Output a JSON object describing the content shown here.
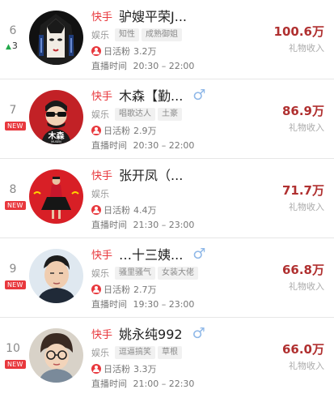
{
  "rows": [
    {
      "rank": "6",
      "change": "3",
      "is_new": false,
      "platform": "快手",
      "name": "驴嫂平荣J...",
      "gender": "",
      "category": "娱乐",
      "tags": [
        "知性",
        "成熟御姐"
      ],
      "fans_label": "日活粉",
      "fans": "3.2万",
      "live_label": "直播时间",
      "live_time": "20:30 – 22:00",
      "amount": "100.6万",
      "amount_label": "礼物收入"
    },
    {
      "rank": "7",
      "change": "",
      "is_new": true,
      "new_text": "NEW",
      "platform": "快手",
      "name": "木森【勤...",
      "gender": "♂",
      "category": "娱乐",
      "tags": [
        "唱歌达人",
        "土豪"
      ],
      "fans_label": "日活粉",
      "fans": "2.9万",
      "live_label": "直播时间",
      "live_time": "20:30 – 22:00",
      "amount": "86.9万",
      "amount_label": "礼物收入"
    },
    {
      "rank": "8",
      "change": "",
      "is_new": true,
      "new_text": "NEW",
      "platform": "快手",
      "name": "张开凤（...",
      "gender": "",
      "category": "娱乐",
      "tags": [],
      "fans_label": "日活粉",
      "fans": "4.4万",
      "live_label": "直播时间",
      "live_time": "21:30 – 23:00",
      "amount": "71.7万",
      "amount_label": "礼物收入"
    },
    {
      "rank": "9",
      "change": "",
      "is_new": true,
      "new_text": "NEW",
      "platform": "快手",
      "name": "…十三姨...",
      "gender": "♂",
      "category": "娱乐",
      "tags": [
        "骚里骚气",
        "女装大佬"
      ],
      "fans_label": "日活粉",
      "fans": "2.7万",
      "live_label": "直播时间",
      "live_time": "19:30 – 23:00",
      "amount": "66.8万",
      "amount_label": "礼物收入"
    },
    {
      "rank": "10",
      "change": "",
      "is_new": true,
      "new_text": "NEW",
      "platform": "快手",
      "name": "姚永纯992",
      "gender": "♂",
      "category": "娱乐",
      "tags": [
        "逗逼搞笑",
        "草根"
      ],
      "fans_label": "日活粉",
      "fans": "3.3万",
      "live_label": "直播时间",
      "live_time": "21:00 – 22:30",
      "amount": "66.0万",
      "amount_label": "礼物收入"
    }
  ],
  "avatar_labels": {
    "row1": "木森",
    "row1_sub": "MUSEN"
  },
  "colors": {
    "accent": "#e8383d",
    "amount": "#b03030",
    "gender": "#8fb8e8",
    "up": "#22a84a"
  }
}
